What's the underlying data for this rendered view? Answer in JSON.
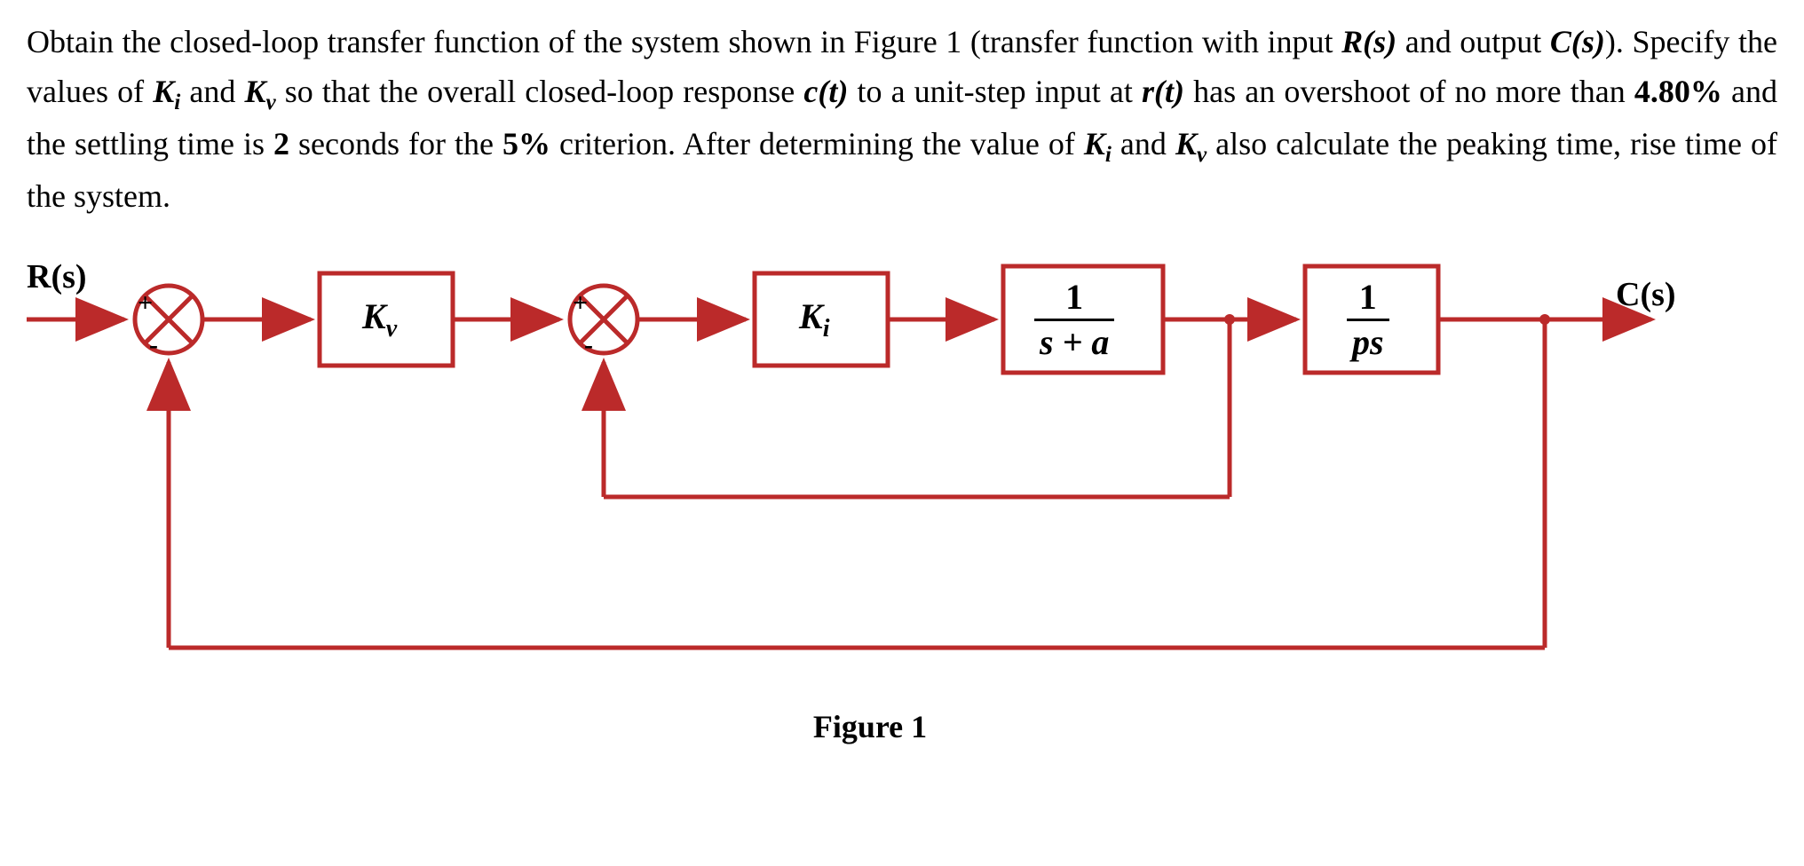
{
  "problem": {
    "sentence1_part1": "Obtain the closed-loop transfer function of the system shown in Figure 1 (transfer function with input ",
    "Rs": "R(s)",
    "sentence1_part2": " and output ",
    "Cs": "C(s)",
    "sentence1_part3": "). Specify the values of ",
    "Ki": "K",
    "Ki_sub": "i",
    "sentence1_part4": " and ",
    "Kv": "K",
    "Kv_sub": "v",
    "sentence1_part5": " so that the overall closed-loop response ",
    "ct": "c(t)",
    "sentence1_part6": " to a unit-step input at ",
    "rt": "r(t)",
    "sentence1_part7": " has an overshoot of no more than ",
    "overshoot": "4.80%",
    "sentence1_part8": " and the settling time is ",
    "settling_time": "2",
    "sentence1_part9": " seconds for the ",
    "criterion": "5%",
    "sentence1_part10": " criterion. After determining the value of ",
    "sentence1_part11": " also calculate the peaking time, rise time of the system."
  },
  "diagram": {
    "input_label": "R(s)",
    "output_label": "C(s)",
    "block_Kv": "K",
    "block_Kv_sub": "v",
    "block_Ki": "K",
    "block_Ki_sub": "i",
    "block3_num": "1",
    "block3_den_a": "s + a",
    "block4_num": "1",
    "block4_den": "ps",
    "sum_plus": "+",
    "sum_minus": "-",
    "caption": "Figure 1"
  }
}
